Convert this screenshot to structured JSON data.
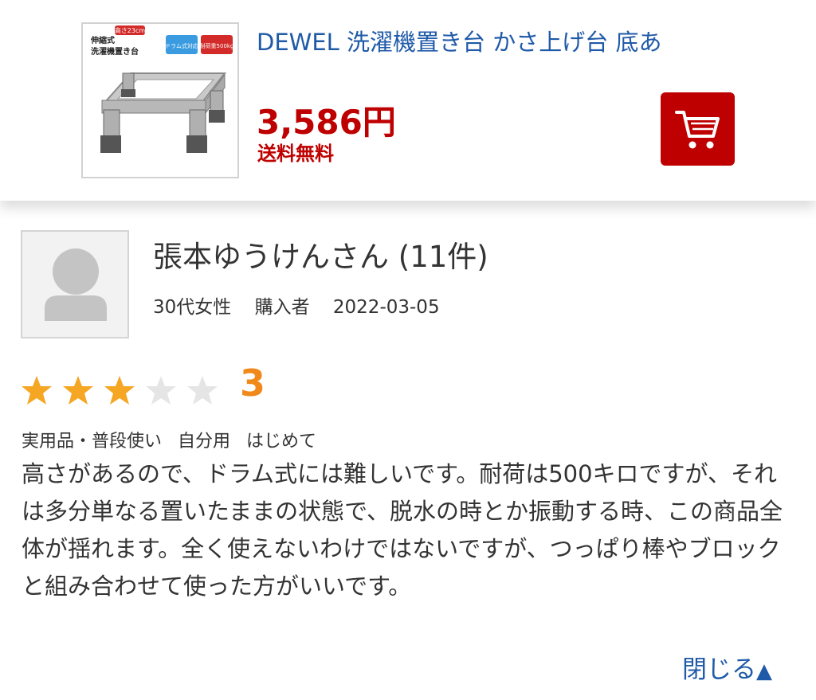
{
  "product": {
    "title": "DEWEL 洗濯機置き台 かさ上げ台 底あ",
    "price": "3,586円",
    "shipping": "送料無料",
    "thumbnail": {
      "badge_top": "高さ23cm",
      "label_main_1": "伸縮式",
      "label_main_2": "洗濯機置き台",
      "badge_blue": "ドラム式対応",
      "badge_red": "耐荷重500kg"
    },
    "cart_icon": "shopping-cart-icon"
  },
  "reviewer": {
    "avatar_icon": "person-silhouette-icon",
    "name": "張本ゆうけんさん (11件)",
    "age_gender": "30代女性",
    "purchase_status": "購入者",
    "date": "2022-03-05"
  },
  "review": {
    "rating": 3,
    "rating_label": "3",
    "stars_max": 5,
    "tags": [
      "実用品・普段使い",
      "自分用",
      "はじめて"
    ],
    "body": "高さがあるので、ドラム式には難しいです。耐荷は500キロですが、それは多分単なる置いたままの状態で、脱水の時とか振動する時、この商品全体が揺れます。全く使えないわけではないですが、つっぱり棒やブロックと組み合わせて使った方がいいです。"
  },
  "close_link": {
    "label": "閉じる",
    "arrow": "▲"
  },
  "colors": {
    "accent_red": "#bf0000",
    "link_blue": "#1f5aa8",
    "star_filled": "#f5a623",
    "star_empty": "#e5e5e5",
    "rating_orange": "#f0891a"
  }
}
